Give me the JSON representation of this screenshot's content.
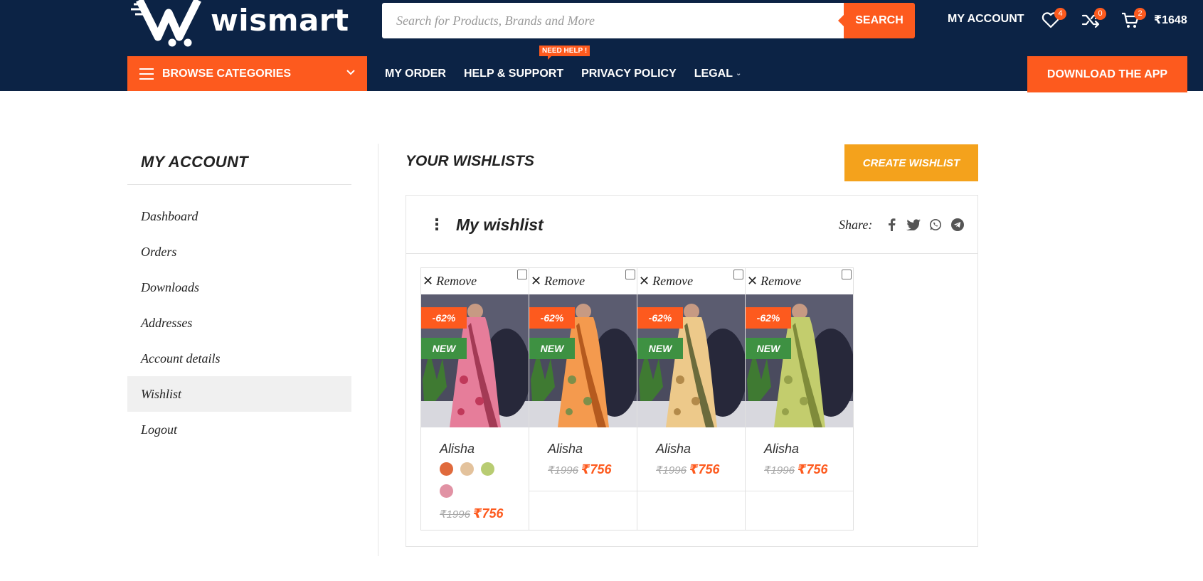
{
  "brand": {
    "name": "wismart"
  },
  "search": {
    "placeholder": "Search for Products, Brands and More",
    "button": "SEARCH"
  },
  "header": {
    "my_account": "MY ACCOUNT",
    "wishlist_count": "4",
    "compare_count": "0",
    "cart_count": "2",
    "cart_total": "₹1648"
  },
  "nav": {
    "browse": "BROWSE CATEGORIES",
    "items": [
      "MY ORDER",
      "HELP & SUPPORT",
      "PRIVACY POLICY",
      "LEGAL"
    ],
    "need_help": "NEED HELP !",
    "download": "DOWNLOAD THE APP"
  },
  "sidebar": {
    "title": "MY ACCOUNT",
    "items": [
      {
        "label": "Dashboard"
      },
      {
        "label": "Orders"
      },
      {
        "label": "Downloads"
      },
      {
        "label": "Addresses"
      },
      {
        "label": "Account details"
      },
      {
        "label": "Wishlist",
        "active": true
      },
      {
        "label": "Logout"
      }
    ]
  },
  "main": {
    "title": "YOUR WISHLISTS",
    "create_button": "CREATE WISHLIST",
    "wishlist_name": "My wishlist",
    "share_label": "Share:",
    "share_icons": [
      "facebook-icon",
      "twitter-icon",
      "whatsapp-icon",
      "telegram-icon"
    ]
  },
  "products": [
    {
      "remove": "Remove",
      "discount": "-62%",
      "badge": "NEW",
      "name": "Alisha",
      "old_price": "₹1996",
      "price": "₹756",
      "swatches": [
        "#e06a3c",
        "#e3c29c",
        "#b8cc72",
        "#e192a4"
      ],
      "palette": "pink"
    },
    {
      "remove": "Remove",
      "discount": "-62%",
      "badge": "NEW",
      "name": "Alisha",
      "old_price": "₹1996",
      "price": "₹756",
      "palette": "orange"
    },
    {
      "remove": "Remove",
      "discount": "-62%",
      "badge": "NEW",
      "name": "Alisha",
      "old_price": "₹1996",
      "price": "₹756",
      "palette": "beige"
    },
    {
      "remove": "Remove",
      "discount": "-62%",
      "badge": "NEW",
      "name": "Alisha",
      "old_price": "₹1996",
      "price": "₹756",
      "palette": "green"
    }
  ],
  "colors": {
    "header_bg": "#0c2345",
    "accent": "#fd5a1e",
    "create_btn": "#f4a21c",
    "new_badge": "#3e9142"
  }
}
